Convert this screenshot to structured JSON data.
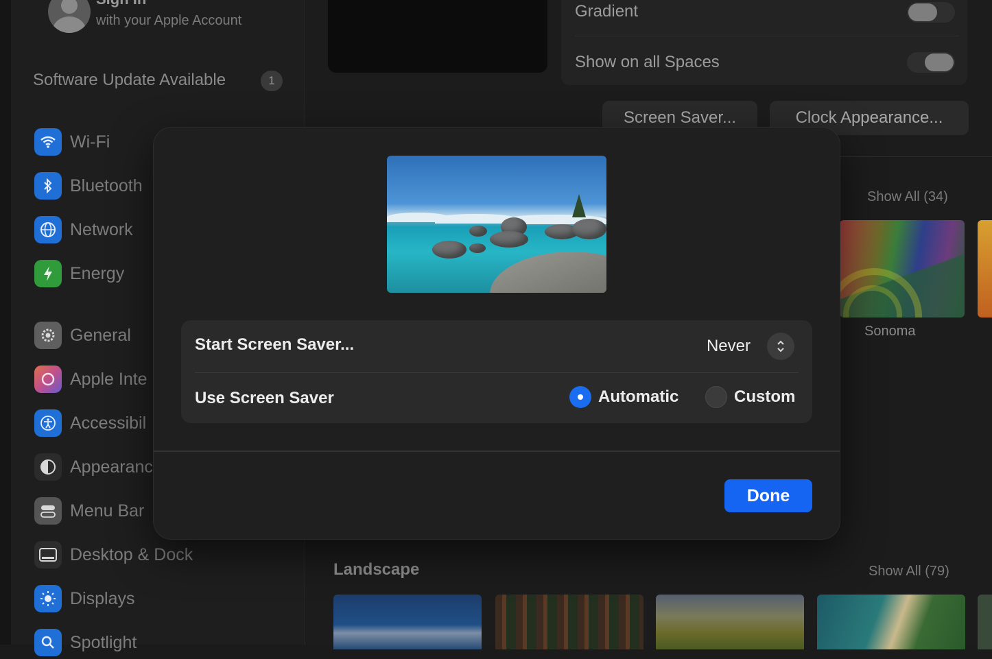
{
  "account": {
    "title": "Sign In",
    "subtitle": "with your Apple Account"
  },
  "software_update": {
    "label": "Software Update Available",
    "badge": "1"
  },
  "sidebar": {
    "items": [
      {
        "label": "Wi-Fi",
        "icon": "wifi-icon",
        "color": "#1f6fd6"
      },
      {
        "label": "Bluetooth",
        "icon": "bluetooth-icon",
        "color": "#1f6fd6"
      },
      {
        "label": "Network",
        "icon": "globe-icon",
        "color": "#1f6fd6"
      },
      {
        "label": "Energy",
        "icon": "bolt-icon",
        "color": "#2f9b3a"
      },
      {
        "label": "General",
        "icon": "gear-icon",
        "color": "#6b6b6b"
      },
      {
        "label": "Apple Inte",
        "icon": "apple-intelligence-icon",
        "color": "#c0508a"
      },
      {
        "label": "Accessibil",
        "icon": "accessibility-icon",
        "color": "#1f6fd6"
      },
      {
        "label": "Appearanc",
        "icon": "appearance-icon",
        "color": "#2a2a2a"
      },
      {
        "label": "Menu Bar",
        "icon": "menu-bar-icon",
        "color": "#5a5a5a"
      },
      {
        "label": "Desktop & Dock",
        "icon": "dock-icon",
        "color": "#3a3a3a"
      },
      {
        "label": "Displays",
        "icon": "sun-icon",
        "color": "#1f6fd6"
      },
      {
        "label": "Spotlight",
        "icon": "search-icon",
        "color": "#1f6fd6"
      }
    ]
  },
  "settings": {
    "gradient_label": "Gradient",
    "gradient_on": false,
    "spaces_label": "Show on all Spaces",
    "spaces_on": true,
    "screen_saver_button": "Screen Saver...",
    "clock_button": "Clock Appearance..."
  },
  "gallery": {
    "show_all_top": "Show All (34)",
    "sonoma_label": "Sonoma",
    "landscape_title": "Landscape",
    "show_all_landscape": "Show All (79)"
  },
  "sheet": {
    "start_label": "Start Screen Saver...",
    "start_value": "Never",
    "use_label": "Use Screen Saver",
    "options": [
      "Automatic",
      "Custom"
    ],
    "selected": "Automatic",
    "done_label": "Done",
    "accent_color": "#1565f2"
  }
}
